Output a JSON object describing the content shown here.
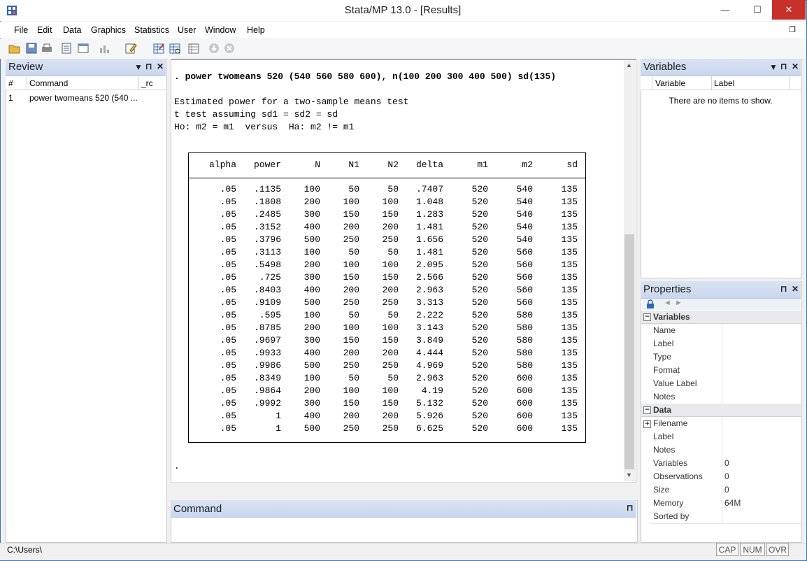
{
  "window": {
    "title": "Stata/MP 13.0 - [Results]"
  },
  "window_controls": {
    "minimize": "—",
    "maximize": "☐",
    "close": "✕",
    "restore": "❐"
  },
  "menu": [
    "File",
    "Edit",
    "Data",
    "Graphics",
    "Statistics",
    "User",
    "Window",
    "Help"
  ],
  "toolbar_icons": [
    "open-icon",
    "save-icon",
    "print-icon",
    "log-icon",
    "viewer-icon",
    "graph-icon",
    "dofile-editor-icon",
    "data-editor-icon",
    "data-browser-icon",
    "variables-manager-icon",
    "more-icon",
    "break-icon"
  ],
  "review": {
    "title": "Review",
    "columns": {
      "num": "#",
      "command": "Command",
      "rc": "_rc"
    },
    "rows": [
      {
        "num": "1",
        "command": "power twomeans 520 (540 ...",
        "rc": ""
      }
    ]
  },
  "variables": {
    "title": "Variables",
    "columns": {
      "variable": "Variable",
      "label": "Label"
    },
    "empty_text": "There are no items to show."
  },
  "results": {
    "command_line": ". power twomeans 520 (540 560 580 600), n(100 200 300 400 500) sd(135)",
    "lines": [
      "Estimated power for a two-sample means test",
      "t test assuming sd1 = sd2 = sd",
      "Ho: m2 = m1  versus  Ha: m2 != m1"
    ],
    "table_headers": [
      "alpha",
      "power",
      "N",
      "N1",
      "N2",
      "delta",
      "m1",
      "m2",
      "sd"
    ],
    "table_rows": [
      [
        ".05",
        ".1135",
        "100",
        "50",
        "50",
        ".7407",
        "520",
        "540",
        "135"
      ],
      [
        ".05",
        ".1808",
        "200",
        "100",
        "100",
        "1.048",
        "520",
        "540",
        "135"
      ],
      [
        ".05",
        ".2485",
        "300",
        "150",
        "150",
        "1.283",
        "520",
        "540",
        "135"
      ],
      [
        ".05",
        ".3152",
        "400",
        "200",
        "200",
        "1.481",
        "520",
        "540",
        "135"
      ],
      [
        ".05",
        ".3796",
        "500",
        "250",
        "250",
        "1.656",
        "520",
        "540",
        "135"
      ],
      [
        ".05",
        ".3113",
        "100",
        "50",
        "50",
        "1.481",
        "520",
        "560",
        "135"
      ],
      [
        ".05",
        ".5498",
        "200",
        "100",
        "100",
        "2.095",
        "520",
        "560",
        "135"
      ],
      [
        ".05",
        ".725",
        "300",
        "150",
        "150",
        "2.566",
        "520",
        "560",
        "135"
      ],
      [
        ".05",
        ".8403",
        "400",
        "200",
        "200",
        "2.963",
        "520",
        "560",
        "135"
      ],
      [
        ".05",
        ".9109",
        "500",
        "250",
        "250",
        "3.313",
        "520",
        "560",
        "135"
      ],
      [
        ".05",
        ".595",
        "100",
        "50",
        "50",
        "2.222",
        "520",
        "580",
        "135"
      ],
      [
        ".05",
        ".8785",
        "200",
        "100",
        "100",
        "3.143",
        "520",
        "580",
        "135"
      ],
      [
        ".05",
        ".9697",
        "300",
        "150",
        "150",
        "3.849",
        "520",
        "580",
        "135"
      ],
      [
        ".05",
        ".9933",
        "400",
        "200",
        "200",
        "4.444",
        "520",
        "580",
        "135"
      ],
      [
        ".05",
        ".9986",
        "500",
        "250",
        "250",
        "4.969",
        "520",
        "580",
        "135"
      ],
      [
        ".05",
        ".8349",
        "100",
        "50",
        "50",
        "2.963",
        "520",
        "600",
        "135"
      ],
      [
        ".05",
        ".9864",
        "200",
        "100",
        "100",
        "4.19",
        "520",
        "600",
        "135"
      ],
      [
        ".05",
        ".9992",
        "300",
        "150",
        "150",
        "5.132",
        "520",
        "600",
        "135"
      ],
      [
        ".05",
        "1",
        "400",
        "200",
        "200",
        "5.926",
        "520",
        "600",
        "135"
      ],
      [
        ".05",
        "1",
        "500",
        "250",
        "250",
        "6.625",
        "520",
        "600",
        "135"
      ]
    ],
    "prompt": "."
  },
  "command": {
    "title": "Command"
  },
  "properties": {
    "title": "Properties",
    "sections": [
      {
        "name": "Variables",
        "items": [
          {
            "key": "Name",
            "value": ""
          },
          {
            "key": "Label",
            "value": ""
          },
          {
            "key": "Type",
            "value": ""
          },
          {
            "key": "Format",
            "value": ""
          },
          {
            "key": "Value Label",
            "value": ""
          },
          {
            "key": "Notes",
            "value": ""
          }
        ]
      },
      {
        "name": "Data",
        "items": [
          {
            "key": "Filename",
            "value": ""
          },
          {
            "key": "Label",
            "value": ""
          },
          {
            "key": "Notes",
            "value": ""
          },
          {
            "key": "Variables",
            "value": "0"
          },
          {
            "key": "Observations",
            "value": "0"
          },
          {
            "key": "Size",
            "value": "0"
          },
          {
            "key": "Memory",
            "value": "64M"
          },
          {
            "key": "Sorted by",
            "value": ""
          }
        ]
      }
    ]
  },
  "status": {
    "path": "C:\\Users\\",
    "indicators": [
      "CAP",
      "NUM",
      "OVR"
    ]
  },
  "panel_icons": {
    "filter": "▼",
    "pin": "⊓",
    "close": "✕"
  }
}
